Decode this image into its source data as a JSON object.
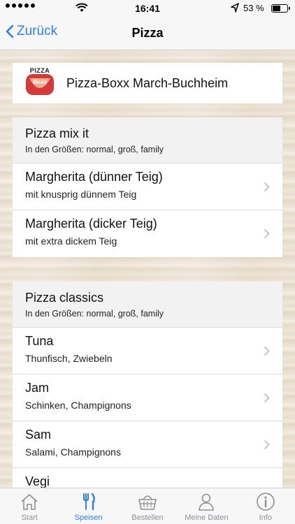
{
  "status_bar": {
    "time": "16:41",
    "battery_percent": "53 %",
    "battery_level": 0.53
  },
  "nav": {
    "back_label": "Zurück",
    "title": "Pizza"
  },
  "restaurant": {
    "name": "Pizza-Boxx March-Buchheim",
    "logo_text_top": "PIZZA",
    "logo_text_mid": "Boxx"
  },
  "sections": [
    {
      "title": "Pizza mix it",
      "subtitle": "In den Größen: normal, groß, family",
      "items": [
        {
          "title": "Margherita (dünner Teig)",
          "subtitle": "mit knusprig dünnem Teig"
        },
        {
          "title": "Margherita (dicker Teig)",
          "subtitle": "mit extra dickem Teig"
        }
      ]
    },
    {
      "title": "Pizza classics",
      "subtitle": "In den Größen: normal, groß, family",
      "items": [
        {
          "title": "Tuna",
          "subtitle": "Thunfisch, Zwiebeln"
        },
        {
          "title": "Jam",
          "subtitle": "Schinken, Champignons"
        },
        {
          "title": "Sam",
          "subtitle": "Salami, Champignons"
        },
        {
          "title": "Vegi",
          "subtitle": ""
        }
      ]
    }
  ],
  "tabs": [
    {
      "label": "Start",
      "icon": "home-icon",
      "active": false
    },
    {
      "label": "Speisen",
      "icon": "fork-knife-icon",
      "active": true
    },
    {
      "label": "Bestellen",
      "icon": "basket-icon",
      "active": false
    },
    {
      "label": "Meine Daten",
      "icon": "person-icon",
      "active": false
    },
    {
      "label": "Info",
      "icon": "info-icon",
      "active": false
    }
  ],
  "colors": {
    "accent": "#2f7cf6",
    "tab_inactive": "#8e8e93",
    "logo_red": "#d6393a"
  }
}
